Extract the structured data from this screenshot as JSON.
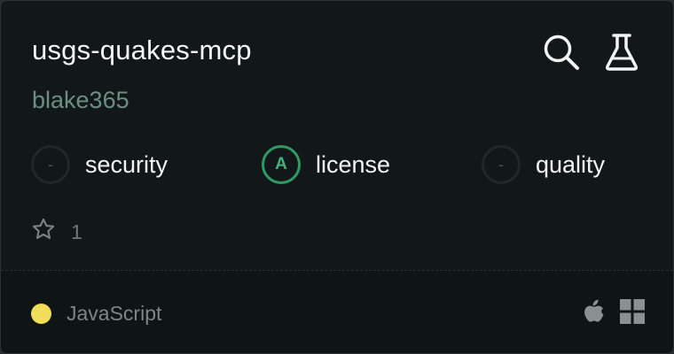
{
  "card": {
    "title": "usgs-quakes-mcp",
    "author": "blake365"
  },
  "actions": [
    {
      "name": "search-icon"
    },
    {
      "name": "flask-icon"
    }
  ],
  "metrics": [
    {
      "label": "security",
      "grade": "-",
      "status": "none"
    },
    {
      "label": "license",
      "grade": "A",
      "status": "good",
      "color": "#2f9a62"
    },
    {
      "label": "quality",
      "grade": "-",
      "status": "none"
    }
  ],
  "stats": {
    "stars": "1",
    "star_icon": "star-outline-icon"
  },
  "footer": {
    "language": "JavaScript",
    "language_color": "#f0dd5a",
    "platform_icons": [
      "apple-icon",
      "windows-icon"
    ]
  },
  "colors": {
    "background": "#121719",
    "footer_background": "#0f1415",
    "author": "#6c8f81",
    "muted": "#6f7779"
  }
}
